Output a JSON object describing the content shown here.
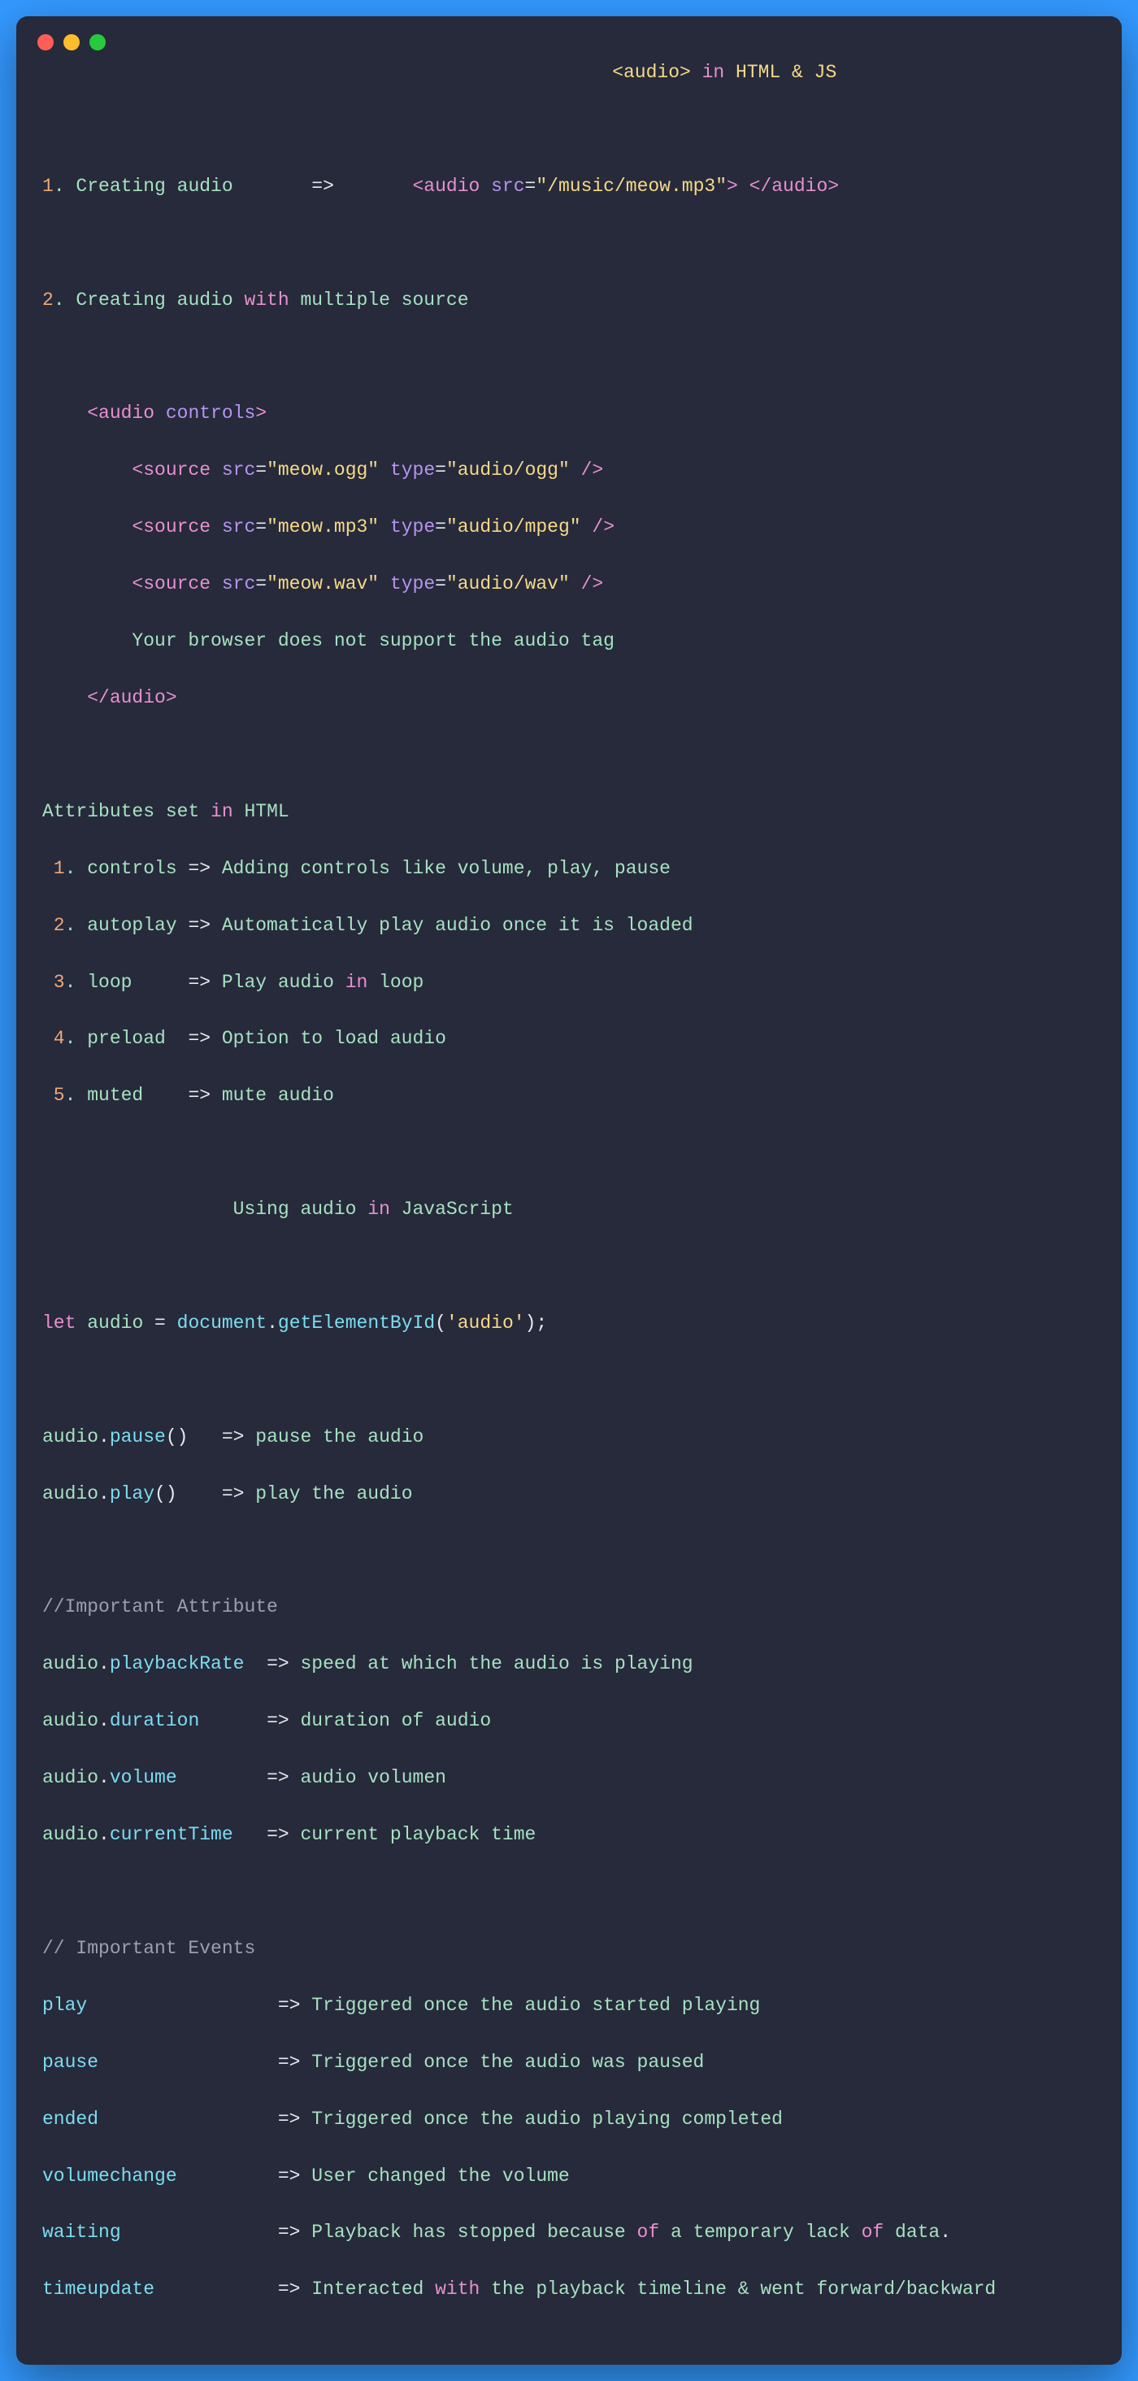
{
  "title_prefix": "<audio> ",
  "title_in": "in",
  "title_suffix": " HTML & JS",
  "sec1_num": "1",
  "sec1_label": ". Creating audio       ",
  "sec1_arrow": "=>",
  "sec1_pad": "       ",
  "sec1_tag_audio_open": "<audio ",
  "sec1_attr_src": "src",
  "sec1_eq": "=",
  "sec1_val_src": "\"/music/meow.mp3\"",
  "sec1_tag_close": ">",
  "sec1_tag_audio_space": " ",
  "sec1_tag_audio_end": "</audio>",
  "sec2_num": "2",
  "sec2_label": ". Creating audio ",
  "sec2_with": "with",
  "sec2_label2": " multiple source",
  "ms_indent1": "    ",
  "ms_audio_open": "<audio ",
  "ms_controls": "controls",
  "ms_gt": ">",
  "ms_indent2": "        ",
  "ms_src_tag": "<source ",
  "ms_src": "src",
  "ms_eq": "=",
  "ms_ogg_val": "\"meow.ogg\"",
  "ms_sp": " ",
  "ms_type": "type",
  "ms_ogg_type": "\"audio/ogg\"",
  "ms_selfclose": " />",
  "ms_mp3_val": "\"meow.mp3\"",
  "ms_mp3_type": "\"audio/mpeg\"",
  "ms_wav_val": "\"meow.wav\"",
  "ms_wav_type": "\"audio/wav\"",
  "ms_fallback": "Your browser does not support the audio tag",
  "ms_audio_close": "</audio>",
  "attrs_title": "Attributes set ",
  "attrs_in": "in",
  "attrs_html": " HTML",
  "attrs": [
    {
      "n": " 1",
      "name": ". controls ",
      "arrow": "=>",
      "desc": " Adding controls like volume, play, pause"
    },
    {
      "n": " 2",
      "name": ". autoplay ",
      "arrow": "=>",
      "desc": " Automatically play audio once it is loaded"
    },
    {
      "n": " 3",
      "name": ". loop     ",
      "arrow": "=>",
      "desc": " Play audio ",
      "in": "in",
      "desc2": " loop"
    },
    {
      "n": " 4",
      "name": ". preload  ",
      "arrow": "=>",
      "desc": " Option to load audio"
    },
    {
      "n": " 5",
      "name": ". muted    ",
      "arrow": "=>",
      "desc": " mute audio"
    }
  ],
  "js_title_pre": "                 Using audio ",
  "js_title_in": "in",
  "js_title_post": " JavaScript",
  "let": "let",
  "let_sp": " ",
  "let_audio": "audio",
  "let_eq": " = ",
  "let_doc": "document",
  "let_dot": ".",
  "let_get": "getElementById",
  "let_open": "(",
  "let_str": "'audio'",
  "let_close": ")",
  "semi": ";",
  "m_audio": "audio",
  "m_dot": ".",
  "m_pause": "pause",
  "m_paren": "()",
  "m_pad1": "   ",
  "m_arrow": "=>",
  "m_pause_desc": " pause the audio",
  "m_play": "play",
  "m_pad2": "    ",
  "m_play_desc": " play the audio",
  "cmt_attr": "//Important Attribute",
  "props": [
    {
      "name": "playbackRate",
      "pad": "  ",
      "desc": " speed at which the audio is playing"
    },
    {
      "name": "duration",
      "pad": "      ",
      "desc": " duration of audio"
    },
    {
      "name": "volume",
      "pad": "        ",
      "desc": " audio volumen"
    },
    {
      "name": "currentTime",
      "pad": "   ",
      "desc": " current playback time"
    }
  ],
  "cmt_events": "// Important Events",
  "events": [
    {
      "name": "play",
      "pad": "                 ",
      "desc": " Triggered once the audio started playing"
    },
    {
      "name": "pause",
      "pad": "                ",
      "desc": " Triggered once the audio was paused"
    },
    {
      "name": "ended",
      "pad": "                ",
      "desc": " Triggered once the audio playing completed"
    },
    {
      "name": "volumechange",
      "pad": "         ",
      "desc": " User changed the volume"
    },
    {
      "name": "waiting",
      "pad": "              ",
      "desc": " Playback has stopped because ",
      "of": "of",
      "desc2": " a temporary lack ",
      "of2": "of",
      "desc3": " data",
      "dot": "."
    },
    {
      "name": "timeupdate",
      "pad": "           ",
      "desc": " Interacted ",
      "with": "with",
      "desc2": " the playback timeline & went forward/backward"
    }
  ]
}
